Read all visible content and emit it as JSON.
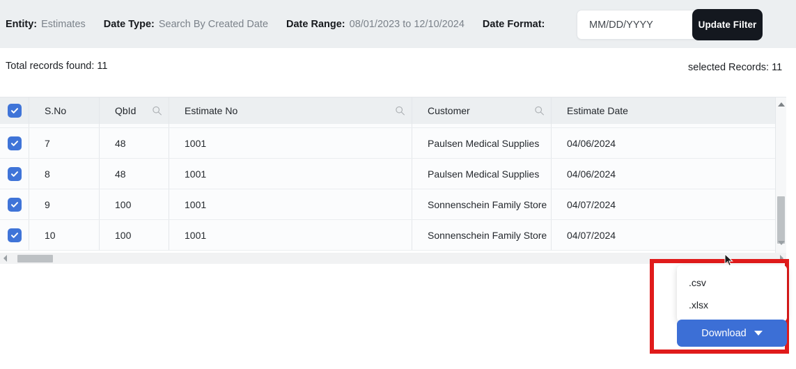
{
  "filter_bar": {
    "entity_label": "Entity:",
    "entity_value": "Estimates",
    "date_type_label": "Date Type:",
    "date_type_value": "Search By Created Date",
    "date_range_label": "Date Range:",
    "date_range_value": "08/01/2023 to 12/10/2024",
    "date_format_label": "Date Format:",
    "date_format_value": "MM/DD/YYYY",
    "date_format_placeholder": "MM/DD/YYYY",
    "update_filter_button": "Update Filter",
    "background_color": "#eceff1",
    "update_button_color": "#14181f"
  },
  "counts": {
    "total_records": "Total records found: 11",
    "selected_records": "selected Records: 11"
  },
  "table": {
    "select_all_checked": true,
    "columns": [
      {
        "key": "sno",
        "label": "S.No",
        "has_search": false
      },
      {
        "key": "qbid",
        "label": "QbId",
        "has_search": true
      },
      {
        "key": "est",
        "label": "Estimate No",
        "has_search": true
      },
      {
        "key": "cust",
        "label": "Customer",
        "has_search": true
      },
      {
        "key": "date",
        "label": "Estimate Date",
        "has_search": false
      }
    ],
    "rows": [
      {
        "checked": true,
        "sno": "7",
        "qbid": "48",
        "est": "1001",
        "cust": "Paulsen Medical Supplies",
        "date": "04/06/2024"
      },
      {
        "checked": true,
        "sno": "8",
        "qbid": "48",
        "est": "1001",
        "cust": "Paulsen Medical Supplies",
        "date": "04/06/2024"
      },
      {
        "checked": true,
        "sno": "9",
        "qbid": "100",
        "est": "1001",
        "cust": "Sonnenschein Family Store",
        "date": "04/07/2024"
      },
      {
        "checked": true,
        "sno": "10",
        "qbid": "100",
        "est": "1001",
        "cust": "Sonnenschein Family Store",
        "date": "04/07/2024"
      }
    ],
    "checkbox_color": "#3f74d8",
    "header_background": "#eceff1"
  },
  "download": {
    "menu_items": [
      ".csv",
      ".xlsx"
    ],
    "button_label": "Download",
    "button_color": "#3c6fd6",
    "highlight_color": "#e01b1b"
  }
}
